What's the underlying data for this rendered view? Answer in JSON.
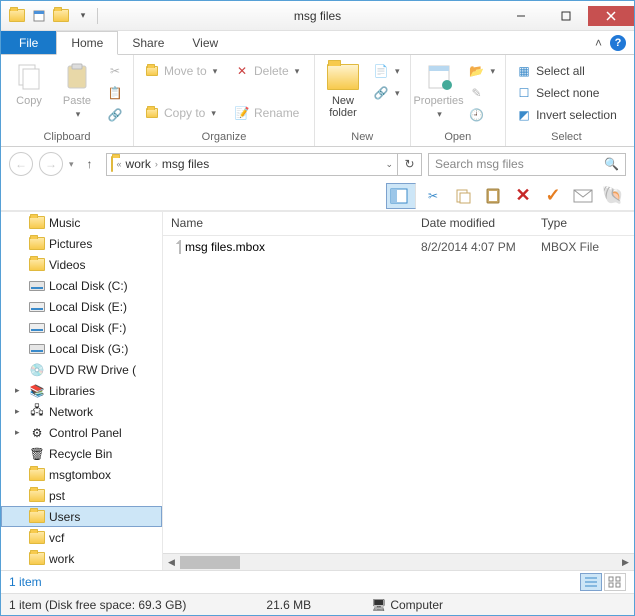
{
  "window": {
    "title": "msg files"
  },
  "tabs": {
    "file": "File",
    "home": "Home",
    "share": "Share",
    "view": "View"
  },
  "ribbon": {
    "clipboard": {
      "label": "Clipboard",
      "copy": "Copy",
      "paste": "Paste"
    },
    "organize": {
      "label": "Organize",
      "moveto": "Move to",
      "copyto": "Copy to",
      "delete": "Delete",
      "rename": "Rename"
    },
    "new": {
      "label": "New",
      "newfolder": "New\nfolder"
    },
    "open": {
      "label": "Open",
      "properties": "Properties"
    },
    "select": {
      "label": "Select",
      "all": "Select all",
      "none": "Select none",
      "invert": "Invert selection"
    }
  },
  "address": {
    "part1": "work",
    "part2": "msg files"
  },
  "search": {
    "placeholder": "Search msg files"
  },
  "columns": {
    "name": "Name",
    "date": "Date modified",
    "type": "Type"
  },
  "files": [
    {
      "name": "msg files.mbox",
      "date": "8/2/2014 4:07 PM",
      "type": "MBOX File"
    }
  ],
  "nav": {
    "music": "Music",
    "pictures": "Pictures",
    "videos": "Videos",
    "diskc": "Local Disk (C:)",
    "diske": "Local Disk (E:)",
    "diskf": "Local Disk (F:)",
    "diskg": "Local Disk (G:)",
    "dvd": "DVD RW Drive (",
    "libraries": "Libraries",
    "network": "Network",
    "cpanel": "Control Panel",
    "recycle": "Recycle Bin",
    "msgtombox": "msgtombox",
    "pst": "pst",
    "users": "Users",
    "vcf": "vcf",
    "work": "work"
  },
  "status": {
    "count": "1 item",
    "diskfree": "1 item (Disk free space: 69.3 GB)",
    "size": "21.6 MB",
    "computer": "Computer"
  }
}
